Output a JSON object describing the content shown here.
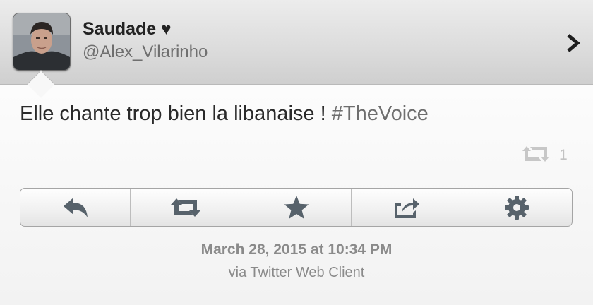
{
  "author": {
    "display_name": "Saudade",
    "heart": "♥",
    "handle": "@Alex_Vilarinho"
  },
  "tweet": {
    "text": "Elle chante trop bien la libanaise ! ",
    "hashtag": "#TheVoice",
    "retweet_count": "1"
  },
  "actions": [
    {
      "icon": "reply-icon"
    },
    {
      "icon": "retweet-icon"
    },
    {
      "icon": "star-icon"
    },
    {
      "icon": "share-icon"
    },
    {
      "icon": "gear-icon"
    }
  ],
  "meta": {
    "timestamp": "March 28, 2015 at 10:34 PM",
    "source": "via Twitter Web Client"
  },
  "colors": {
    "icon": "#57626b",
    "hashtag": "#6e6e6e",
    "muted": "#8a8a8a"
  }
}
